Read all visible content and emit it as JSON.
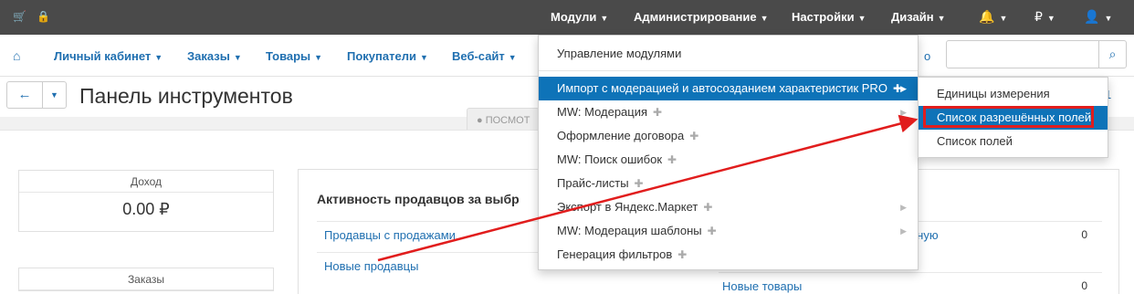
{
  "topbar": {
    "nav": [
      {
        "label": "Модули",
        "active": true
      },
      {
        "label": "Администрирование"
      },
      {
        "label": "Настройки"
      },
      {
        "label": "Дизайн"
      }
    ],
    "currency": "₽",
    "icons": [
      "cart-icon",
      "lock-icon",
      "bell-icon",
      "user-icon"
    ]
  },
  "navbar": {
    "items": [
      {
        "label": "Личный кабинет"
      },
      {
        "label": "Заказы"
      },
      {
        "label": "Товары"
      },
      {
        "label": "Покупатели"
      },
      {
        "label": "Веб-сайт"
      }
    ],
    "truncated_right": "о"
  },
  "page": {
    "title": "Панель инструментов",
    "view_chip": "ПОСМОТ",
    "title_right_trunc": "1"
  },
  "stats": [
    {
      "label": "Доход",
      "value": "0.00 ₽"
    },
    {
      "label": "Заказы",
      "value": ""
    }
  ],
  "activity": {
    "title": "Активность продавцов за выбр",
    "left_rows": [
      "Продавцы с продажами",
      "Новые продавцы"
    ],
    "right_rows": [
      {
        "label": "ётную",
        "value": "0"
      },
      {
        "label": "Новые товары",
        "value": "0"
      }
    ]
  },
  "dropdown": {
    "items": [
      {
        "label": "Управление модулями",
        "puzzle": false,
        "submenu": false
      },
      {
        "label": "Импорт с модерацией и автосозданием характеристик PRO",
        "puzzle": true,
        "submenu": true,
        "active": true
      },
      {
        "label": "MW: Модерация",
        "puzzle": true,
        "submenu": true
      },
      {
        "label": "Оформление договора",
        "puzzle": true,
        "submenu": false
      },
      {
        "label": "MW: Поиск ошибок",
        "puzzle": true,
        "submenu": false
      },
      {
        "label": "Прайс-листы",
        "puzzle": true,
        "submenu": false
      },
      {
        "label": "Экспорт в Яндекс.Маркет",
        "puzzle": true,
        "submenu": true
      },
      {
        "label": "MW: Модерация шаблоны",
        "puzzle": true,
        "submenu": true
      },
      {
        "label": "Генерация фильтров",
        "puzzle": true,
        "submenu": false
      }
    ]
  },
  "submenu": {
    "items": [
      {
        "label": "Единицы измерения"
      },
      {
        "label": "Список разрешённых полей",
        "active": true
      },
      {
        "label": "Список полей"
      }
    ]
  },
  "colors": {
    "topbar": "#4a4a4a",
    "link": "#1f6fb0",
    "menu_active": "#0e73b8",
    "annotation": "#e11d1d"
  }
}
